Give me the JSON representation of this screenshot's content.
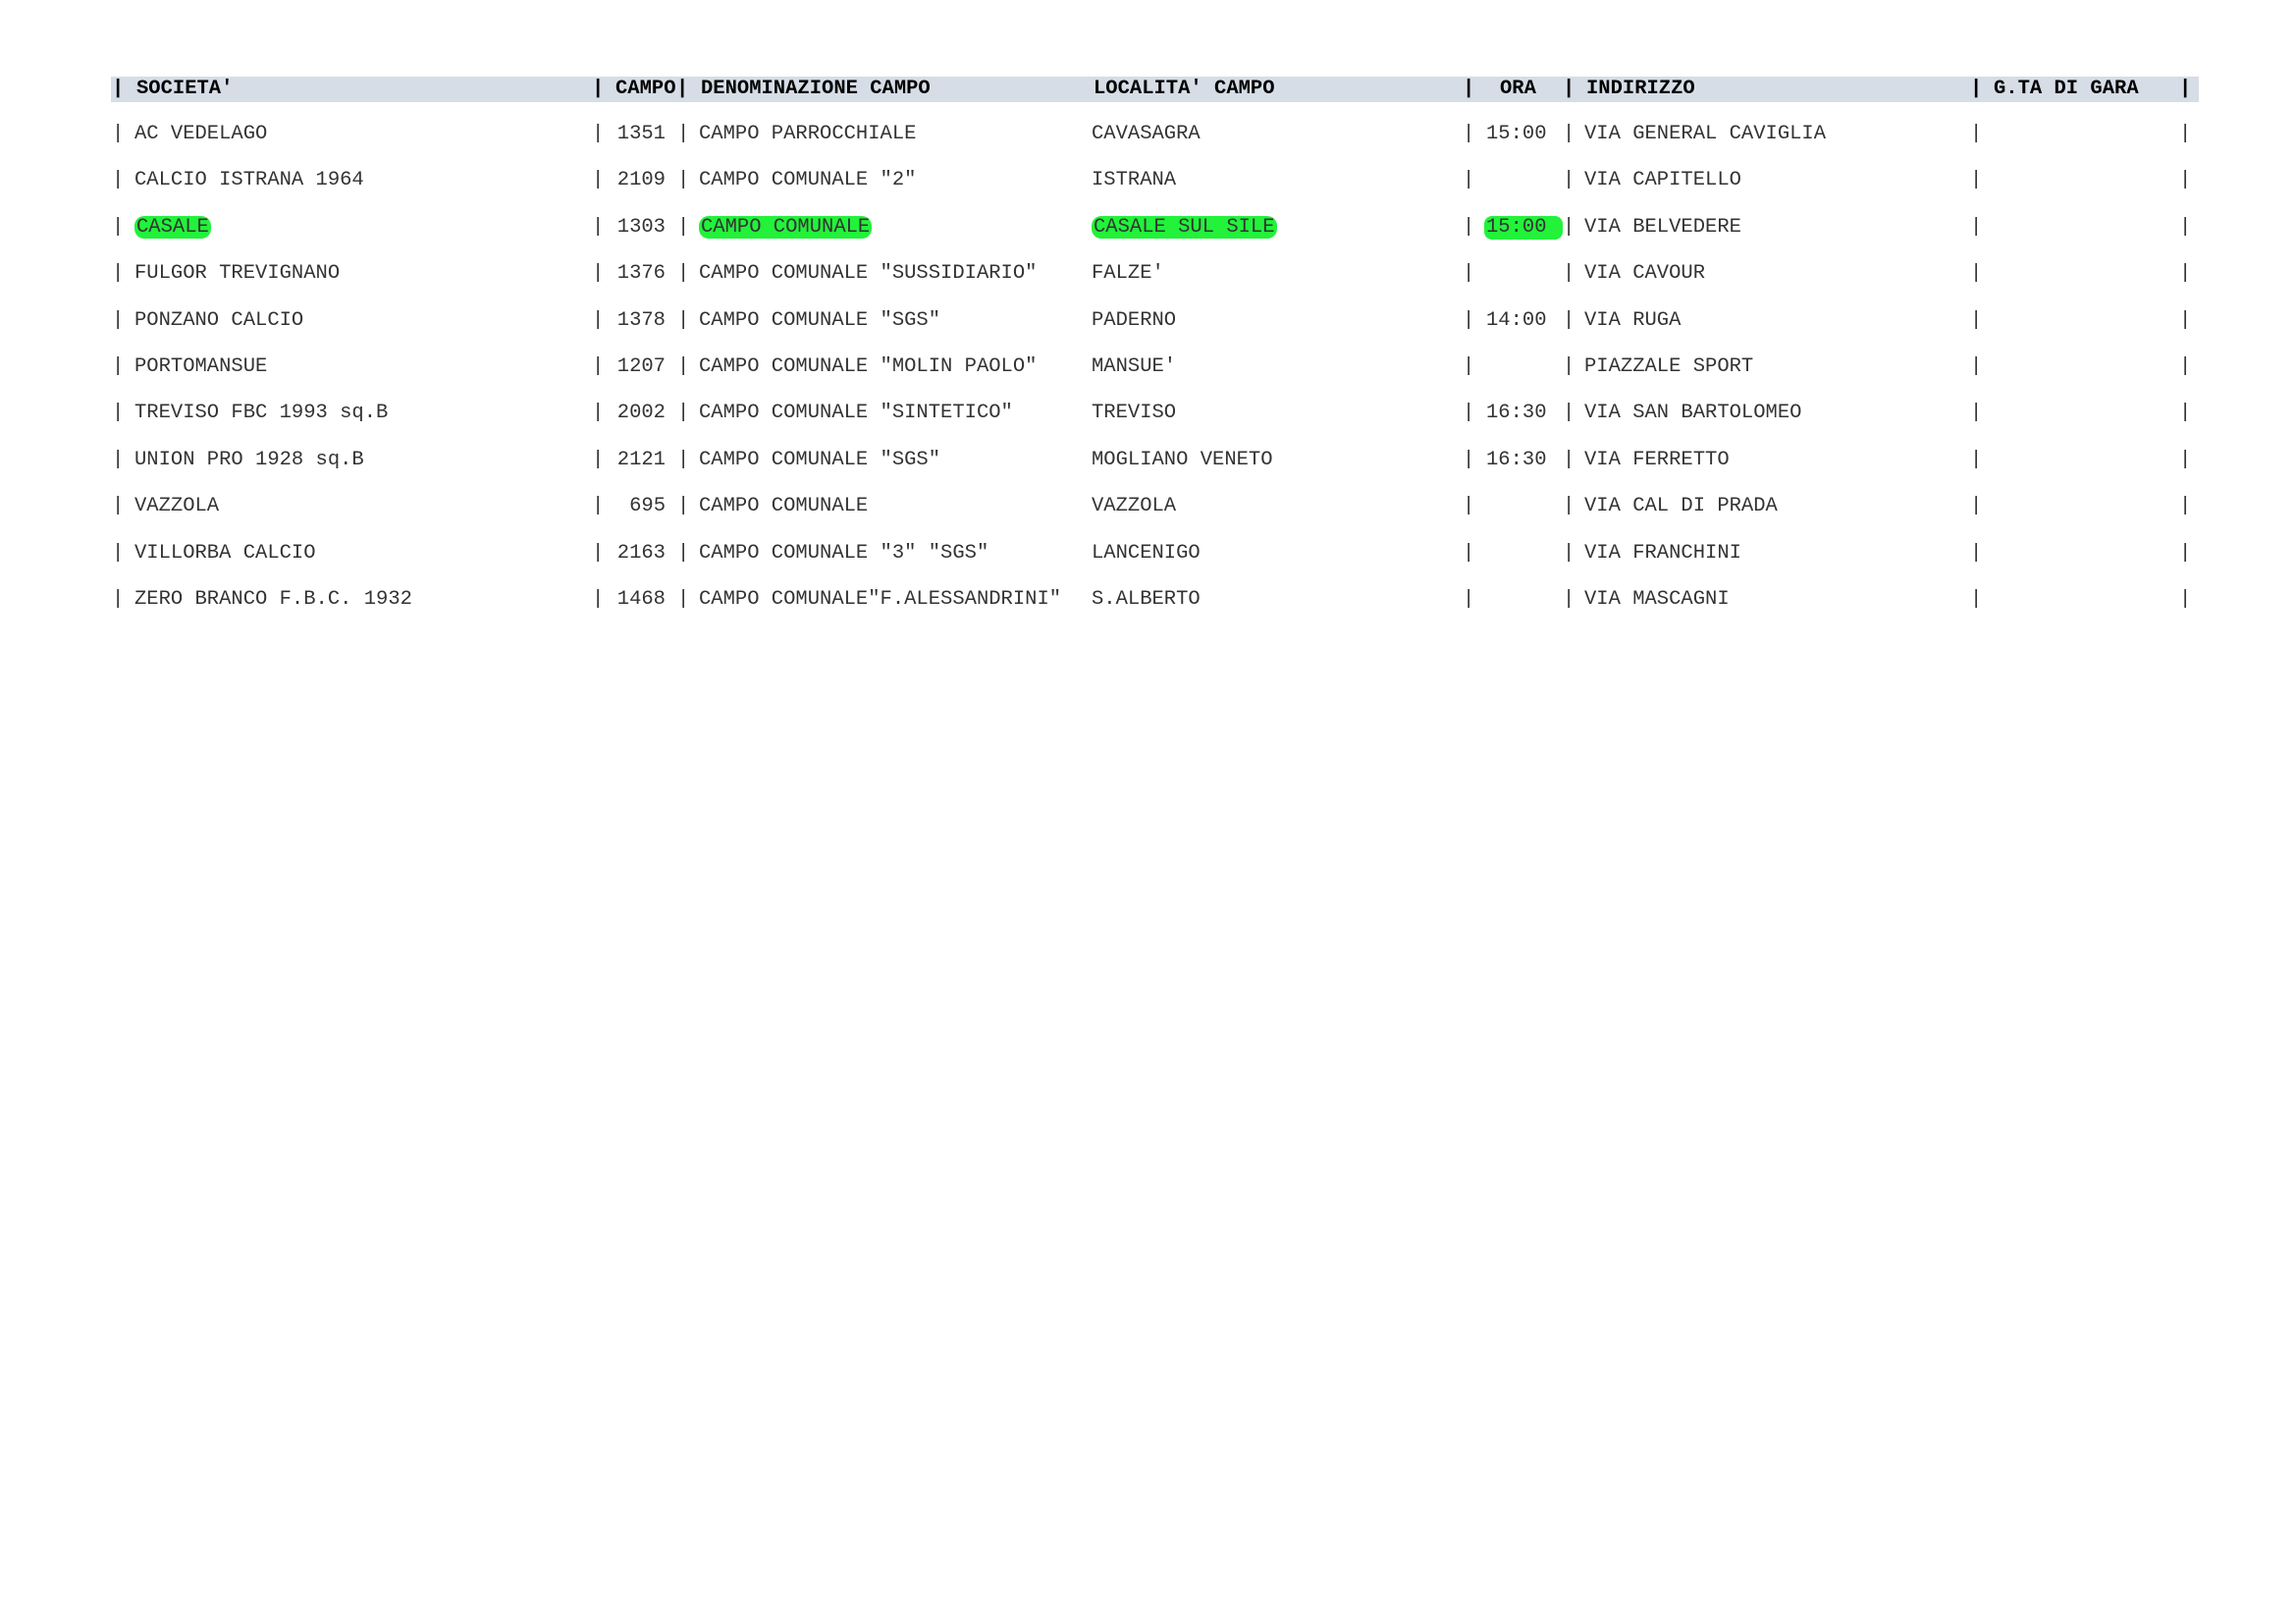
{
  "headers": {
    "societa": "SOCIETA'",
    "campo": "CAMPO",
    "denominazione": "DENOMINAZIONE CAMPO",
    "localita": "LOCALITA' CAMPO",
    "ora": "ORA",
    "indirizzo": "INDIRIZZO",
    "gta": "G.TA DI GARA"
  },
  "highlight_color": "#22f23a",
  "rows": [
    {
      "societa": "AC VEDELAGO",
      "campo": "1351",
      "denominazione": "CAMPO PARROCCHIALE",
      "localita": "CAVASAGRA",
      "ora": "15:00",
      "indirizzo": "VIA GENERAL CAVIGLIA",
      "gta": ""
    },
    {
      "societa": "CALCIO ISTRANA 1964",
      "campo": "2109",
      "denominazione": "CAMPO COMUNALE \"2\"",
      "localita": "ISTRANA",
      "ora": "",
      "indirizzo": "VIA CAPITELLO",
      "gta": ""
    },
    {
      "societa": "CASALE",
      "campo": "1303",
      "denominazione": "CAMPO COMUNALE",
      "localita": "CASALE SUL SILE",
      "ora": "15:00",
      "indirizzo": "VIA BELVEDERE",
      "gta": ""
    },
    {
      "societa": "FULGOR TREVIGNANO",
      "campo": "1376",
      "denominazione": "CAMPO COMUNALE \"SUSSIDIARIO\"",
      "localita": "FALZE'",
      "ora": "",
      "indirizzo": "VIA CAVOUR",
      "gta": ""
    },
    {
      "societa": "PONZANO CALCIO",
      "campo": "1378",
      "denominazione": "CAMPO COMUNALE \"SGS\"",
      "localita": "PADERNO",
      "ora": "14:00",
      "indirizzo": "VIA RUGA",
      "gta": ""
    },
    {
      "societa": "PORTOMANSUE",
      "campo": "1207",
      "denominazione": "CAMPO COMUNALE \"MOLIN PAOLO\"",
      "localita": "MANSUE'",
      "ora": "",
      "indirizzo": "PIAZZALE SPORT",
      "gta": ""
    },
    {
      "societa": "TREVISO FBC 1993 sq.B",
      "campo": "2002",
      "denominazione": "CAMPO COMUNALE \"SINTETICO\"",
      "localita": "TREVISO",
      "ora": "16:30",
      "indirizzo": "VIA SAN BARTOLOMEO",
      "gta": ""
    },
    {
      "societa": "UNION PRO 1928 sq.B",
      "campo": "2121",
      "denominazione": "CAMPO COMUNALE \"SGS\"",
      "localita": "MOGLIANO VENETO",
      "ora": "16:30",
      "indirizzo": "VIA FERRETTO",
      "gta": ""
    },
    {
      "societa": "VAZZOLA",
      "campo": "695",
      "denominazione": "CAMPO COMUNALE",
      "localita": "VAZZOLA",
      "ora": "",
      "indirizzo": "VIA CAL DI PRADA",
      "gta": ""
    },
    {
      "societa": "VILLORBA CALCIO",
      "campo": "2163",
      "denominazione": "CAMPO COMUNALE \"3\" \"SGS\"",
      "localita": "LANCENIGO",
      "ora": "",
      "indirizzo": "VIA FRANCHINI",
      "gta": ""
    },
    {
      "societa": "ZERO BRANCO F.B.C. 1932",
      "campo": "1468",
      "denominazione": "CAMPO COMUNALE\"F.ALESSANDRINI\"",
      "localita": "S.ALBERTO",
      "ora": "",
      "indirizzo": "VIA MASCAGNI",
      "gta": ""
    }
  ]
}
